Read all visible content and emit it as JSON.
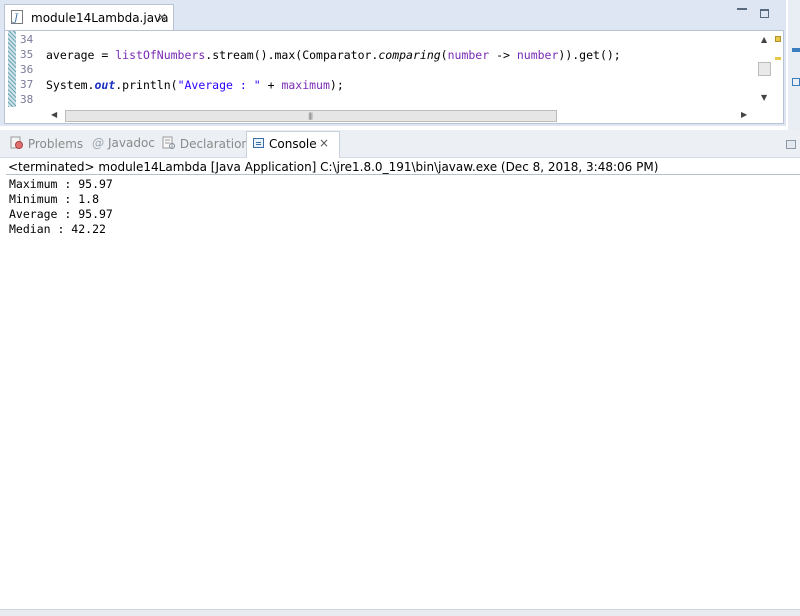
{
  "editor": {
    "tab_label": "module14Lambda.java",
    "tab_close": "×",
    "lines": [
      {
        "num": "34",
        "code": ""
      },
      {
        "num": "35",
        "code_parts": [
          "average = ",
          "listOfNumbers",
          ".stream().max(Comparator.",
          "comparing",
          "(",
          "number",
          " -> ",
          "number",
          ")).get();"
        ]
      },
      {
        "num": "36",
        "code": ""
      },
      {
        "num": "37",
        "code_parts": [
          "System.",
          "out",
          ".println(",
          "\"Average : \"",
          " + ",
          "maximum",
          ");"
        ]
      },
      {
        "num": "38",
        "code": ""
      }
    ]
  },
  "views": {
    "tabs": [
      {
        "label": "Problems",
        "icon": "problems-icon"
      },
      {
        "label": "Javadoc",
        "icon": "at-icon"
      },
      {
        "label": "Declaration",
        "icon": "declaration-icon"
      }
    ],
    "active_tab": {
      "label": "Console",
      "close": "×"
    }
  },
  "console": {
    "header": "<terminated> module14Lambda [Java Application] C:\\jre1.8.0_191\\bin\\javaw.exe (Dec 8, 2018, 3:48:06 PM)",
    "output": [
      "Maximum : 95.97",
      "Minimum : 1.8",
      "Average : 95.97",
      "Median : 42.22"
    ]
  }
}
